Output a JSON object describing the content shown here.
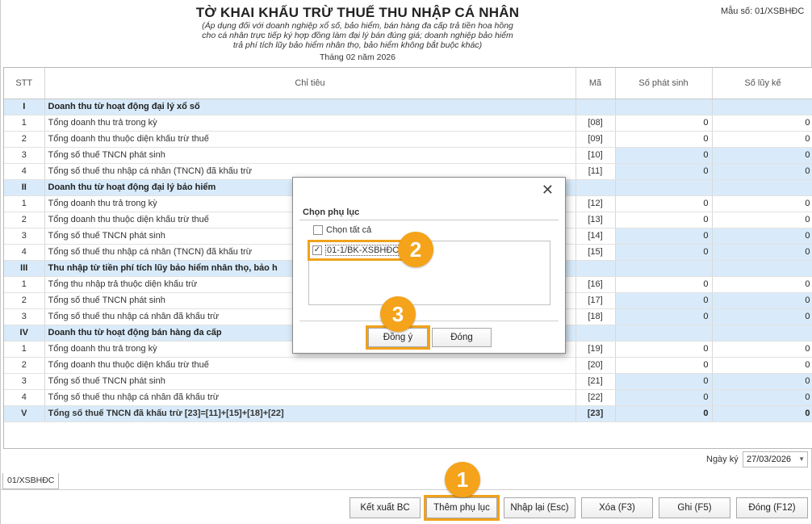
{
  "header": {
    "title": "TỜ KHAI KHẤU TRỪ THUẾ THU NHẬP CÁ NHÂN",
    "subtitle_lines": [
      "(Áp dụng đối với doanh nghiệp xổ số, bảo hiểm, bán hàng đa cấp trả tiền hoa hồng",
      "cho cá nhân trực tiếp ký hợp đồng làm đại lý bán đúng giá; doanh nghiệp bảo hiểm",
      "trả phí tích lũy bảo hiểm nhân thọ, bảo hiểm không bắt buộc khác)"
    ],
    "period": "Tháng 02 năm 2026",
    "form_code": "Mẫu số: 01/XSBHĐC"
  },
  "table": {
    "columns": [
      "STT",
      "Chỉ tiêu",
      "Mã",
      "Số phát sinh",
      "Số lũy kế"
    ],
    "rows": [
      {
        "type": "section",
        "stt": "I",
        "name": "Doanh thu từ hoạt động đại lý xổ số",
        "code": "",
        "ps": "",
        "lk": ""
      },
      {
        "type": "row",
        "stt": "1",
        "name": "Tổng doanh thu trả trong kỳ",
        "code": "[08]",
        "ps": "0",
        "lk": "0",
        "blue": false
      },
      {
        "type": "row",
        "stt": "2",
        "name": "Tổng doanh thu thuộc diện khấu trừ thuế",
        "code": "[09]",
        "ps": "0",
        "lk": "0",
        "blue": false
      },
      {
        "type": "row",
        "stt": "3",
        "name": "Tổng số thuế TNCN phát sinh",
        "code": "[10]",
        "ps": "0",
        "lk": "0",
        "blue": true
      },
      {
        "type": "row",
        "stt": "4",
        "name": "Tổng số thuế thu nhập cá nhân (TNCN) đã khấu trừ",
        "code": "[11]",
        "ps": "0",
        "lk": "0",
        "blue": true
      },
      {
        "type": "section",
        "stt": "II",
        "name": "Doanh thu từ hoạt động đại lý bảo hiểm",
        "code": "",
        "ps": "",
        "lk": ""
      },
      {
        "type": "row",
        "stt": "1",
        "name": "Tổng doanh thu trả trong kỳ",
        "code": "[12]",
        "ps": "0",
        "lk": "0",
        "blue": false
      },
      {
        "type": "row",
        "stt": "2",
        "name": "Tổng doanh thu thuộc diện khấu trừ thuế",
        "code": "[13]",
        "ps": "0",
        "lk": "0",
        "blue": false
      },
      {
        "type": "row",
        "stt": "3",
        "name": "Tổng số thuế TNCN phát sinh",
        "code": "[14]",
        "ps": "0",
        "lk": "0",
        "blue": true
      },
      {
        "type": "row",
        "stt": "4",
        "name": "Tổng số thuế thu nhập cá nhân (TNCN) đã khấu trừ",
        "code": "[15]",
        "ps": "0",
        "lk": "0",
        "blue": true
      },
      {
        "type": "section",
        "stt": "III",
        "name": "Thu nhập từ tiền phí tích lũy bảo hiểm nhân thọ, bảo h",
        "code": "",
        "ps": "",
        "lk": ""
      },
      {
        "type": "row",
        "stt": "1",
        "name": "Tổng thu nhập trả thuộc diện khấu trừ",
        "code": "[16]",
        "ps": "0",
        "lk": "0",
        "blue": false
      },
      {
        "type": "row",
        "stt": "2",
        "name": "Tổng số thuế TNCN phát sinh",
        "code": "[17]",
        "ps": "0",
        "lk": "0",
        "blue": true
      },
      {
        "type": "row",
        "stt": "3",
        "name": "Tổng số thuế thu nhập cá nhân đã khấu trừ",
        "code": "[18]",
        "ps": "0",
        "lk": "0",
        "blue": true
      },
      {
        "type": "section",
        "stt": "IV",
        "name": "Doanh thu từ hoạt động bán hàng đa cấp",
        "code": "",
        "ps": "",
        "lk": ""
      },
      {
        "type": "row",
        "stt": "1",
        "name": "Tổng doanh thu trả trong kỳ",
        "code": "[19]",
        "ps": "0",
        "lk": "0",
        "blue": false
      },
      {
        "type": "row",
        "stt": "2",
        "name": "Tổng doanh thu thuộc diện khấu trừ thuế",
        "code": "[20]",
        "ps": "0",
        "lk": "0",
        "blue": false
      },
      {
        "type": "row",
        "stt": "3",
        "name": "Tổng số thuế TNCN phát sinh",
        "code": "[21]",
        "ps": "0",
        "lk": "0",
        "blue": true
      },
      {
        "type": "row",
        "stt": "4",
        "name": "Tổng số thuế thu nhập cá nhân đã khấu trừ",
        "code": "[22]",
        "ps": "0",
        "lk": "0",
        "blue": true
      },
      {
        "type": "total",
        "stt": "V",
        "name": "Tổng số thuế TNCN đã khấu trừ [23]=[11]+[15]+[18]+[22]",
        "code": "[23]",
        "ps": "0",
        "lk": "0"
      }
    ]
  },
  "footer": {
    "date_label": "Ngày ký",
    "date_value": "27/03/2026",
    "tab_label": "01/XSBHĐC"
  },
  "buttons": {
    "export": "Kết xuất BC",
    "add_appendix": "Thêm phụ lục",
    "reset": "Nhập lại (Esc)",
    "delete": "Xóa (F3)",
    "save": "Ghi (F5)",
    "close": "Đóng (F12)"
  },
  "dialog": {
    "group_title": "Chọn phụ lục",
    "select_all": "Chọn tất cả",
    "select_all_checked": false,
    "items": [
      {
        "label": "01-1/BK-XSBHĐC",
        "checked": true
      }
    ],
    "ok": "Đồng ý",
    "cancel": "Đóng",
    "close_glyph": "✕"
  },
  "callouts": [
    "1",
    "2",
    "3"
  ],
  "colors": {
    "highlight": "#f0a21c",
    "badge": "#f5a31a",
    "row_blue": "#d9ebfa"
  }
}
